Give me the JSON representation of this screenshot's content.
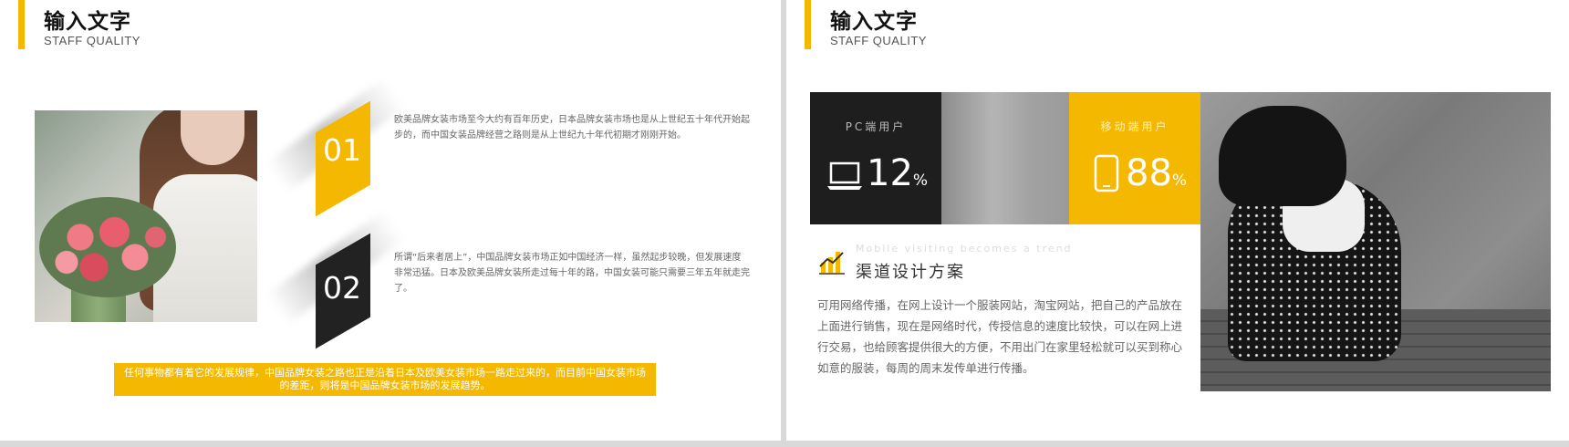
{
  "left": {
    "title": "输入文字",
    "subtitle": "STAFF QUALITY",
    "items": [
      {
        "number": "01",
        "text": "欧美品牌女装市场至今大约有百年历史，日本品牌女装市场也是从上世纪五十年代开始起步的，而中国女装品牌经营之路则是从上世纪九十年代初期才刚刚开始。"
      },
      {
        "number": "02",
        "text": "所谓“后来者居上”，中国品牌女装市场正如中国经济一样，虽然起步较晚，但发展速度非常迅猛。日本及欧美品牌女装所走过每十年的路，中国女装可能只需要三年五年就走完了。"
      }
    ],
    "highlight": "任何事物都有着它的发展规律，中国品牌女装之路也正是沿着日本及欧美女装市场一路走过来的，而目前中国女装市场的差距，则将是中国品牌女装市场的发展趋势。"
  },
  "right": {
    "title": "输入文字",
    "subtitle": "STAFF QUALITY",
    "stats": [
      {
        "label": "PC端用户",
        "value": "12",
        "unit": "%",
        "icon": "laptop-icon"
      },
      {
        "label": "移动端用户",
        "value": "88",
        "unit": "%",
        "icon": "phone-icon"
      }
    ],
    "tagline": "Mobile visiting becomes a trend",
    "section_title": "渠道设计方案",
    "section_body": "可用网络传播，在网上设计一个服装网站，淘宝网站，把自己的产品放在上面进行销售，现在是网络时代，传授信息的速度比较快，可以在网上进行交易，也给顾客提供很大的方便，不用出门在家里轻松就可以买到称心如意的服装，每周的周末发传单进行传播。"
  },
  "colors": {
    "accent": "#f5b800",
    "dark": "#1e1e1e"
  }
}
